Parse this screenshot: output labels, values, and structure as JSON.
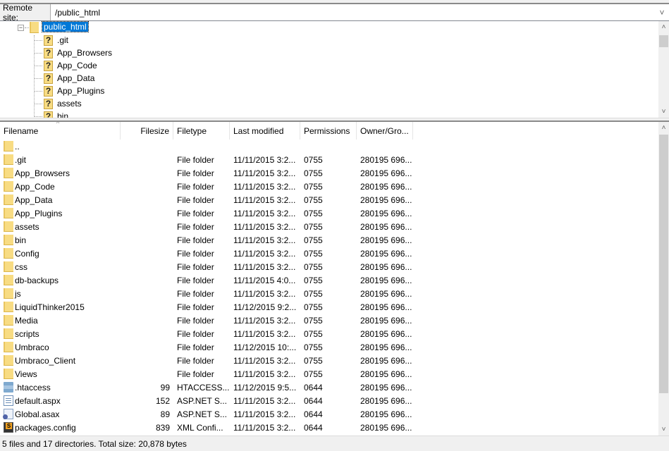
{
  "remote_site": {
    "label": "Remote site:",
    "path": "/public_html"
  },
  "tree": {
    "root": {
      "label": "public_html",
      "icon": "folder-icon",
      "expanded": true,
      "selected": true
    },
    "children": [
      {
        "label": ".git",
        "icon": "unknown-folder-icon"
      },
      {
        "label": "App_Browsers",
        "icon": "unknown-folder-icon"
      },
      {
        "label": "App_Code",
        "icon": "unknown-folder-icon"
      },
      {
        "label": "App_Data",
        "icon": "unknown-folder-icon"
      },
      {
        "label": "App_Plugins",
        "icon": "unknown-folder-icon"
      },
      {
        "label": "assets",
        "icon": "unknown-folder-icon"
      },
      {
        "label": "bin",
        "icon": "unknown-folder-icon"
      }
    ],
    "unknown_glyph": "?"
  },
  "file_list": {
    "columns": [
      {
        "label": "Filename",
        "sorted": true
      },
      {
        "label": "Filesize"
      },
      {
        "label": "Filetype"
      },
      {
        "label": "Last modified"
      },
      {
        "label": "Permissions"
      },
      {
        "label": "Owner/Gro..."
      }
    ],
    "sort_glyph": "^",
    "rows": [
      {
        "name": "..",
        "size": "",
        "type": "",
        "modified": "",
        "perms": "",
        "owner": "",
        "icon": "folder"
      },
      {
        "name": ".git",
        "size": "",
        "type": "File folder",
        "modified": "11/11/2015 3:2...",
        "perms": "0755",
        "owner": "280195 696...",
        "icon": "folder"
      },
      {
        "name": "App_Browsers",
        "size": "",
        "type": "File folder",
        "modified": "11/11/2015 3:2...",
        "perms": "0755",
        "owner": "280195 696...",
        "icon": "folder"
      },
      {
        "name": "App_Code",
        "size": "",
        "type": "File folder",
        "modified": "11/11/2015 3:2...",
        "perms": "0755",
        "owner": "280195 696...",
        "icon": "folder"
      },
      {
        "name": "App_Data",
        "size": "",
        "type": "File folder",
        "modified": "11/11/2015 3:2...",
        "perms": "0755",
        "owner": "280195 696...",
        "icon": "folder"
      },
      {
        "name": "App_Plugins",
        "size": "",
        "type": "File folder",
        "modified": "11/11/2015 3:2...",
        "perms": "0755",
        "owner": "280195 696...",
        "icon": "folder"
      },
      {
        "name": "assets",
        "size": "",
        "type": "File folder",
        "modified": "11/11/2015 3:2...",
        "perms": "0755",
        "owner": "280195 696...",
        "icon": "folder"
      },
      {
        "name": "bin",
        "size": "",
        "type": "File folder",
        "modified": "11/11/2015 3:2...",
        "perms": "0755",
        "owner": "280195 696...",
        "icon": "folder"
      },
      {
        "name": "Config",
        "size": "",
        "type": "File folder",
        "modified": "11/11/2015 3:2...",
        "perms": "0755",
        "owner": "280195 696...",
        "icon": "folder"
      },
      {
        "name": "css",
        "size": "",
        "type": "File folder",
        "modified": "11/11/2015 3:2...",
        "perms": "0755",
        "owner": "280195 696...",
        "icon": "folder"
      },
      {
        "name": "db-backups",
        "size": "",
        "type": "File folder",
        "modified": "11/11/2015 4:0...",
        "perms": "0755",
        "owner": "280195 696...",
        "icon": "folder"
      },
      {
        "name": "js",
        "size": "",
        "type": "File folder",
        "modified": "11/11/2015 3:2...",
        "perms": "0755",
        "owner": "280195 696...",
        "icon": "folder"
      },
      {
        "name": "LiquidThinker2015",
        "size": "",
        "type": "File folder",
        "modified": "11/12/2015 9:2...",
        "perms": "0755",
        "owner": "280195 696...",
        "icon": "folder"
      },
      {
        "name": "Media",
        "size": "",
        "type": "File folder",
        "modified": "11/11/2015 3:2...",
        "perms": "0755",
        "owner": "280195 696...",
        "icon": "folder"
      },
      {
        "name": "scripts",
        "size": "",
        "type": "File folder",
        "modified": "11/11/2015 3:2...",
        "perms": "0755",
        "owner": "280195 696...",
        "icon": "folder"
      },
      {
        "name": "Umbraco",
        "size": "",
        "type": "File folder",
        "modified": "11/12/2015 10:...",
        "perms": "0755",
        "owner": "280195 696...",
        "icon": "folder"
      },
      {
        "name": "Umbraco_Client",
        "size": "",
        "type": "File folder",
        "modified": "11/11/2015 3:2...",
        "perms": "0755",
        "owner": "280195 696...",
        "icon": "folder"
      },
      {
        "name": "Views",
        "size": "",
        "type": "File folder",
        "modified": "11/11/2015 3:2...",
        "perms": "0755",
        "owner": "280195 696...",
        "icon": "folder"
      },
      {
        "name": ".htaccess",
        "size": "99",
        "type": "HTACCESS...",
        "modified": "11/12/2015 9:5...",
        "perms": "0644",
        "owner": "280195 696...",
        "icon": "htaccess"
      },
      {
        "name": "default.aspx",
        "size": "152",
        "type": "ASP.NET S...",
        "modified": "11/11/2015 3:2...",
        "perms": "0644",
        "owner": "280195 696...",
        "icon": "aspx"
      },
      {
        "name": "Global.asax",
        "size": "89",
        "type": "ASP.NET S...",
        "modified": "11/11/2015 3:2...",
        "perms": "0644",
        "owner": "280195 696...",
        "icon": "asax"
      },
      {
        "name": "packages.config",
        "size": "839",
        "type": "XML Confi...",
        "modified": "11/11/2015 3:2...",
        "perms": "0644",
        "owner": "280195 696...",
        "icon": "config"
      }
    ]
  },
  "status_bar": {
    "text": "5 files and 17 directories. Total size: 20,878 bytes"
  },
  "glyphs": {
    "chevron_up": "˄",
    "chevron_down": "˅",
    "collapse": "−"
  },
  "colors": {
    "selection": "#0078d7",
    "folder": "#f8dc83",
    "scroll_thumb": "#cdcdcd"
  }
}
